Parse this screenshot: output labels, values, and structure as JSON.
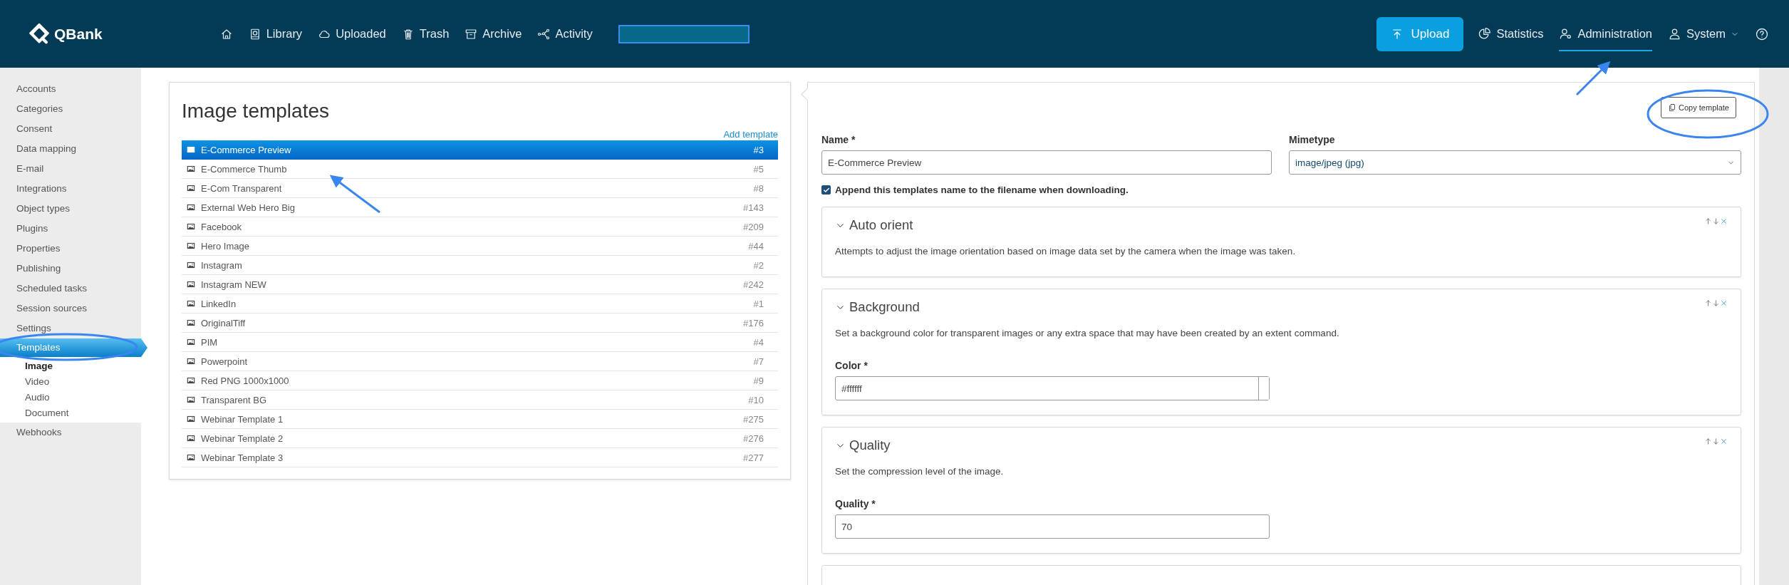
{
  "app": {
    "logo": "QBank"
  },
  "nav": {
    "items": [
      "Library",
      "Uploaded",
      "Trash",
      "Archive",
      "Activity"
    ],
    "upload_button": "Upload",
    "right_items": [
      {
        "label": "Statistics",
        "selected": false
      },
      {
        "label": "Administration",
        "selected": true
      },
      {
        "label": "System",
        "selected": false
      }
    ]
  },
  "sidebar": {
    "items": [
      {
        "label": "Accounts",
        "selected": false
      },
      {
        "label": "Categories",
        "selected": false
      },
      {
        "label": "Consent",
        "selected": false
      },
      {
        "label": "Data mapping",
        "selected": false
      },
      {
        "label": "E-mail",
        "selected": false
      },
      {
        "label": "Integrations",
        "selected": false
      },
      {
        "label": "Object types",
        "selected": false
      },
      {
        "label": "Plugins",
        "selected": false
      },
      {
        "label": "Properties",
        "selected": false
      },
      {
        "label": "Publishing",
        "selected": false
      },
      {
        "label": "Scheduled tasks",
        "selected": false
      },
      {
        "label": "Session sources",
        "selected": false
      },
      {
        "label": "Settings",
        "selected": false
      },
      {
        "label": "Templates",
        "selected": true,
        "children": [
          {
            "label": "Image",
            "selected": true
          },
          {
            "label": "Video",
            "selected": false
          },
          {
            "label": "Audio",
            "selected": false
          },
          {
            "label": "Document",
            "selected": false
          }
        ]
      },
      {
        "label": "Webhooks",
        "selected": false
      }
    ]
  },
  "templates": {
    "title": "Image templates",
    "add_link": "Add template",
    "rows": [
      {
        "name": "E-Commerce Preview",
        "id": "#3",
        "selected": true
      },
      {
        "name": "E-Commerce Thumb",
        "id": "#5",
        "selected": false
      },
      {
        "name": "E-Com Transparent",
        "id": "#8",
        "selected": false
      },
      {
        "name": "External Web Hero Big",
        "id": "#143",
        "selected": false
      },
      {
        "name": "Facebook",
        "id": "#209",
        "selected": false
      },
      {
        "name": "Hero Image",
        "id": "#44",
        "selected": false
      },
      {
        "name": "Instagram",
        "id": "#2",
        "selected": false
      },
      {
        "name": "Instagram NEW",
        "id": "#242",
        "selected": false
      },
      {
        "name": "LinkedIn",
        "id": "#1",
        "selected": false
      },
      {
        "name": "OriginalTiff",
        "id": "#176",
        "selected": false
      },
      {
        "name": "PIM",
        "id": "#4",
        "selected": false
      },
      {
        "name": "Powerpoint",
        "id": "#7",
        "selected": false
      },
      {
        "name": "Red PNG 1000x1000",
        "id": "#9",
        "selected": false
      },
      {
        "name": "Transparent BG",
        "id": "#10",
        "selected": false
      },
      {
        "name": "Webinar Template 1",
        "id": "#275",
        "selected": false
      },
      {
        "name": "Webinar Template 2",
        "id": "#276",
        "selected": false
      },
      {
        "name": "Webinar Template 3",
        "id": "#277",
        "selected": false
      }
    ]
  },
  "editor": {
    "copy_button": "Copy template",
    "name_field": {
      "label": "Name *",
      "value": "E-Commerce Preview"
    },
    "mimetype": {
      "label": "Mimetype",
      "value": "image/jpeg (jpg)"
    },
    "append_checkbox": {
      "label": "Append this templates name to the filename when downloading.",
      "checked": true
    },
    "sections": [
      {
        "title": "Auto orient",
        "description": "Attempts to adjust the image orientation based on image data set by the camera when the image was taken."
      },
      {
        "title": "Background",
        "description": "Set a background color for transparent images or any extra space that may have been created by an extent command.",
        "field": {
          "kind": "color",
          "label": "Color *",
          "value": "#ffffff"
        }
      },
      {
        "title": "Quality",
        "description": "Set the compression level of the image.",
        "field": {
          "kind": "text",
          "label": "Quality *",
          "value": "70"
        }
      }
    ]
  }
}
